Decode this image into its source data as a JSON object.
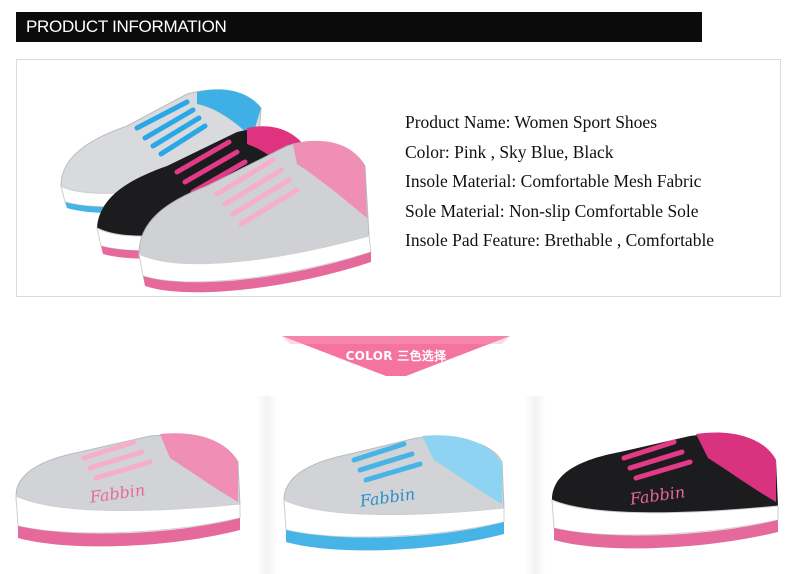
{
  "header": {
    "title": "PRODUCT INFORMATION"
  },
  "specs": [
    {
      "text": "Product Name: Women Sport Shoes"
    },
    {
      "text": "Color: Pink , Sky Blue, Black"
    },
    {
      "text": "Insole Material: Comfortable Mesh Fabric"
    },
    {
      "text": "Sole Material: Non-slip Comfortable Sole"
    },
    {
      "text": "Insole Pad Feature: Brethable , Comfortable"
    }
  ],
  "color_banner": {
    "label": "COLOR 三色选择"
  },
  "brand_logo_text": "Fabbin",
  "colors": {
    "banner": "#f4739f",
    "pink": "#e6699b",
    "light_pink": "#f7aecb",
    "sky_blue": "#47b4e8",
    "black": "#1c1c1e",
    "gray_upper": "#cfd1d4",
    "magenta": "#d9327e"
  },
  "variants": [
    {
      "color": "Pink"
    },
    {
      "color": "Sky Blue"
    },
    {
      "color": "Black"
    }
  ]
}
